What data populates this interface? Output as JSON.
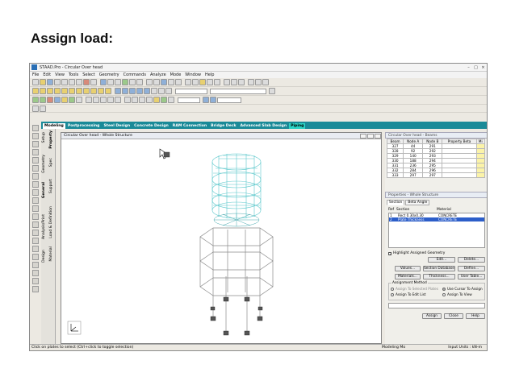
{
  "slide": {
    "title": "Assign load:"
  },
  "window": {
    "title": "STAAD.Pro - Circular Over head"
  },
  "menu": [
    "File",
    "Edit",
    "View",
    "Tools",
    "Select",
    "Geometry",
    "Commands",
    "Analyze",
    "Mode",
    "Window",
    "Help"
  ],
  "ribbon_tabs": [
    {
      "label": "Modeling",
      "active": true
    },
    {
      "label": "Postprocessing"
    },
    {
      "label": "Steel Design"
    },
    {
      "label": "Concrete Design"
    },
    {
      "label": "RAM Connection"
    },
    {
      "label": "Bridge Deck"
    },
    {
      "label": "Advanced Slab Design"
    },
    {
      "label": "Piping"
    }
  ],
  "side_tabs": [
    "Setup",
    "Geometry",
    "General",
    "Analysis/Print",
    "Design"
  ],
  "side_subtabs": [
    "Property",
    "Spec",
    "Support",
    "Load & Definition",
    "Material"
  ],
  "viewport": {
    "title": "Circular Over head - Whole Structure"
  },
  "beams_window": {
    "title": "Circular Over head - Beams",
    "columns": [
      "Beam",
      "Node A",
      "Node B",
      "Property Beta",
      "Mi"
    ],
    "rows": [
      [
        "327",
        "44",
        "291"
      ],
      [
        "328",
        "92",
        "292"
      ],
      [
        "329",
        "140",
        "293"
      ],
      [
        "330",
        "188",
        "294"
      ],
      [
        "331",
        "236",
        "295"
      ],
      [
        "332",
        "284",
        "296"
      ],
      [
        "333",
        "297",
        "297"
      ]
    ]
  },
  "properties": {
    "title": "Properties - Whole Structure",
    "tabs": [
      "Section",
      "Beta Angle"
    ],
    "list_headers": {
      "ref": "Ref",
      "section": "Section",
      "material": "Material"
    },
    "rows": [
      {
        "ref": "1",
        "section": "Rect 0.30x0.30",
        "material": "CONCRETE",
        "selected": false
      },
      {
        "ref": "2",
        "section": "Plate Thickness",
        "material": "CONCRETE",
        "selected": true
      }
    ],
    "highlight_label": "Highlight Assigned Geometry",
    "buttons": {
      "edit": "Edit...",
      "delete": "Delete...",
      "values": "Values...",
      "section_database": "Section Database",
      "define": "Define...",
      "materials": "Materials...",
      "thickness": "Thickness...",
      "user_table": "User Table...",
      "assign": "Assign",
      "close": "Close",
      "help": "Help"
    },
    "assignment": {
      "label": "Assignment Method",
      "to_selected": "Assign To Selected Plates",
      "to_edit_list": "Assign To Edit List",
      "use_cursor": "Use Cursor To Assign",
      "to_view": "Assign To View"
    }
  },
  "status": {
    "left": "Click on plates to select (Ctrl+click to toggle selection)",
    "mode": "Modeling Mo",
    "units": "Input Units : kN-m"
  },
  "colors": {
    "ribbon": "#1a8a98",
    "tank_mesh": "#5cc8cc",
    "selection": "#2c5ec9"
  }
}
